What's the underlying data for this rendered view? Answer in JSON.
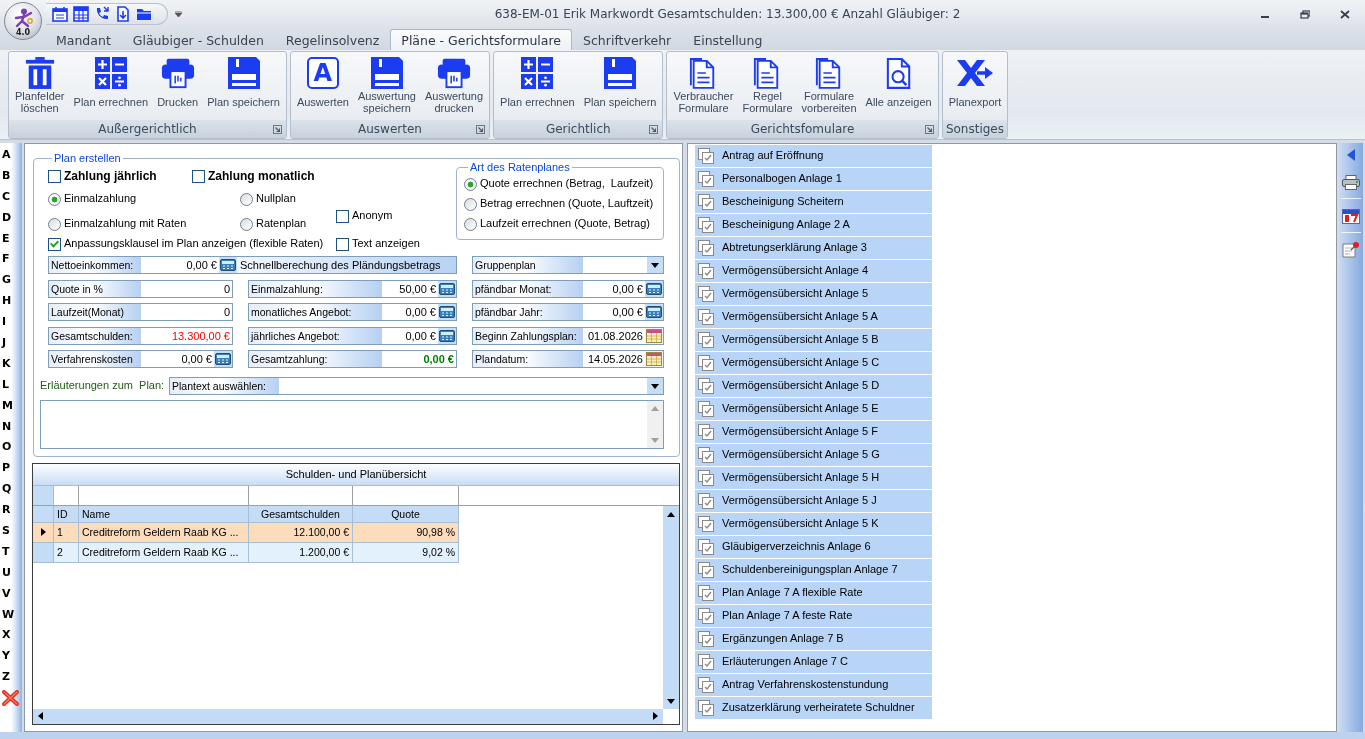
{
  "app": {
    "version": "4.0"
  },
  "window": {
    "title": "638-EM-01 Erik Markwordt Gesamtschulden: 13.300,00 € Anzahl Gläubiger: 2"
  },
  "tabs": [
    {
      "label": "Mandant",
      "selected": false
    },
    {
      "label": "Gläubiger - Schulden",
      "selected": false
    },
    {
      "label": "Regelinsolvenz",
      "selected": false
    },
    {
      "label": "Pläne - Gerichtsformulare",
      "selected": true
    },
    {
      "label": "Schriftverkehr",
      "selected": false
    },
    {
      "label": "Einstellung",
      "selected": false
    }
  ],
  "ribbon": [
    {
      "label": "Außergerichtlich",
      "launcher": true,
      "buttons": [
        {
          "label": "Planfelder\nlöschen",
          "kind": "trash"
        },
        {
          "label": "Plan errechnen",
          "kind": "calculator"
        },
        {
          "label": "Drucken",
          "kind": "printer"
        },
        {
          "label": "Plan speichern",
          "kind": "save"
        }
      ]
    },
    {
      "label": "Auswerten",
      "launcher": true,
      "buttons": [
        {
          "label": "Auswerten",
          "kind": "letter",
          "glyph": "A"
        },
        {
          "label": "Auswertung\nspeichern",
          "kind": "save"
        },
        {
          "label": "Auswertung\ndrucken",
          "kind": "printer"
        }
      ]
    },
    {
      "label": "Gerichtlich",
      "launcher": true,
      "buttons": [
        {
          "label": "Plan errechnen",
          "kind": "calculator"
        },
        {
          "label": "Plan speichern",
          "kind": "save"
        }
      ]
    },
    {
      "label": "Gerichtsfomulare",
      "launcher": true,
      "buttons": [
        {
          "label": "Verbraucher\nFormulare",
          "kind": "documents"
        },
        {
          "label": "Regel\nFormulare",
          "kind": "documents"
        },
        {
          "label": "Formulare\nvorbereiten",
          "kind": "documents"
        },
        {
          "label": "Alle anzeigen",
          "kind": "preview"
        }
      ]
    },
    {
      "label": "Sonstiges",
      "launcher": false,
      "buttons": [
        {
          "label": "Planexport",
          "kind": "export"
        }
      ]
    }
  ],
  "index_letters": [
    "A",
    "B",
    "C",
    "D",
    "E",
    "F",
    "G",
    "H",
    "I",
    "J",
    "K",
    "L",
    "M",
    "N",
    "O",
    "P",
    "Q",
    "R",
    "S",
    "T",
    "U",
    "V",
    "W",
    "X",
    "Y",
    "Z"
  ],
  "plan_form": {
    "title": "Plan erstellen",
    "payment_interval": [
      {
        "label": "Zahlung jährlich",
        "checked": false
      },
      {
        "label": "Zahlung monatlich",
        "checked": false
      }
    ],
    "plan_type": [
      {
        "label": "Einmalzahlung",
        "selected": true
      },
      {
        "label": "Nullplan",
        "selected": false
      },
      {
        "label": "Einmalzahlung mit Raten",
        "selected": false
      },
      {
        "label": "Ratenplan",
        "selected": false
      }
    ],
    "options": [
      {
        "label": "Anonym",
        "checked": false
      },
      {
        "label": "Anpassungsklausel im Plan anzeigen (flexible Raten)",
        "checked": true
      },
      {
        "label": "Text anzeigen",
        "checked": false
      }
    ],
    "rate_plan": {
      "title": "Art des Ratenplanes",
      "options": [
        {
          "label": "Quote errechnen (Betrag,  Laufzeit)",
          "selected": true
        },
        {
          "label": "Betrag errechnen (Quote, Lauftzeit)",
          "selected": false
        },
        {
          "label": "Laufzeit errechnen (Quote, Betrag)",
          "selected": false
        }
      ]
    },
    "fields": [
      [
        {
          "kind": "calc",
          "label": "Nettoeinkommen:",
          "value": "0,00 €"
        },
        {
          "kind": "banner",
          "label": "Schnellberechung des Pländungsbetrags"
        },
        {
          "kind": "dropdown",
          "label": "Gruppenplan"
        }
      ],
      [
        {
          "kind": "input",
          "label": "Quote in %",
          "value": "0"
        },
        {
          "kind": "calc",
          "label": "Einmalzahlung:",
          "value": "50,00 €"
        },
        {
          "kind": "calc",
          "label": "pfändbar Monat:",
          "value": "0,00 €"
        }
      ],
      [
        {
          "kind": "input",
          "label": "Laufzeit(Monat)",
          "value": "0"
        },
        {
          "kind": "calc",
          "label": "monatliches Angebot:",
          "value": "0,00 €"
        },
        {
          "kind": "calc",
          "label": "pfändbar Jahr:",
          "value": "0,00 €"
        }
      ],
      [
        {
          "kind": "input",
          "label": "Gesamtschulden:",
          "value": "13.300,00 €",
          "color": "#ff0000"
        },
        {
          "kind": "calc",
          "label": "jährliches Angebot:",
          "value": "0,00 €"
        },
        {
          "kind": "date",
          "label": "Beginn Zahlungsplan:",
          "value": "01.08.2026"
        }
      ],
      [
        {
          "kind": "calc",
          "label": "Verfahrenskosten",
          "value": "0,00 €"
        },
        {
          "kind": "input",
          "label": "Gesamtzahlung:",
          "value": "0,00 €",
          "color": "#008000",
          "bold": true
        },
        {
          "kind": "date",
          "label": "Plandatum:",
          "value": "14.05.2026"
        }
      ]
    ],
    "explanation": {
      "label": "Erläuterungen zum  Plan:",
      "dropdown_label": "Plantext auswählen:"
    }
  },
  "debt_table": {
    "title": "Schulden- und Planübersicht",
    "columns": [
      "ID",
      "Name",
      "Gesamtschulden",
      "Quote"
    ],
    "rows": [
      {
        "cells": [
          "1",
          "Creditreform Geldern Raab KG ...",
          "12.100,00 €",
          "90,98 %"
        ],
        "selected": true
      },
      {
        "cells": [
          "2",
          "Creditreform Geldern Raab KG ...",
          "1.200,00 €",
          "9,02 %"
        ],
        "selected": false
      }
    ]
  },
  "forms": [
    "Antrag auf Eröffnung",
    "Personalbogen Anlage 1",
    "Bescheinigung Scheitern",
    "Bescheinigung Anlage 2 A",
    "Abtretungserklärung Anlage 3",
    "Vermögensübersicht Anlage 4",
    "Vermögensübersicht Anlage 5",
    "Vermögensübersicht Anlage 5 A",
    "Vermögensübersicht Anlage 5 B",
    "Vermögensübersicht Anlage 5 C",
    "Vermögensübersicht Anlage 5 D",
    "Vermögensübersicht Anlage 5 E",
    "Vermögensübersicht Anlage 5 F",
    "Vermögensübersicht Anlage 5 G",
    "Vermögensübersicht Anlage 5 H",
    "Vermögensübersicht Anlage 5 J",
    "Vermögensübersicht Anlage 5 K",
    "Gläubigerverzeichnis Anlage 6",
    "Schuldenbereinigungsplan Anlage 7",
    "Plan Anlage 7 A flexible Rate",
    "Plan Anlage 7 A feste Rate",
    "Ergänzungen Anlage 7 B",
    "Erläuterungen Anlage 7 C",
    "Antrag Verfahrenskostenstundung",
    "Zusatzerklärung verheiratete Schuldner"
  ]
}
